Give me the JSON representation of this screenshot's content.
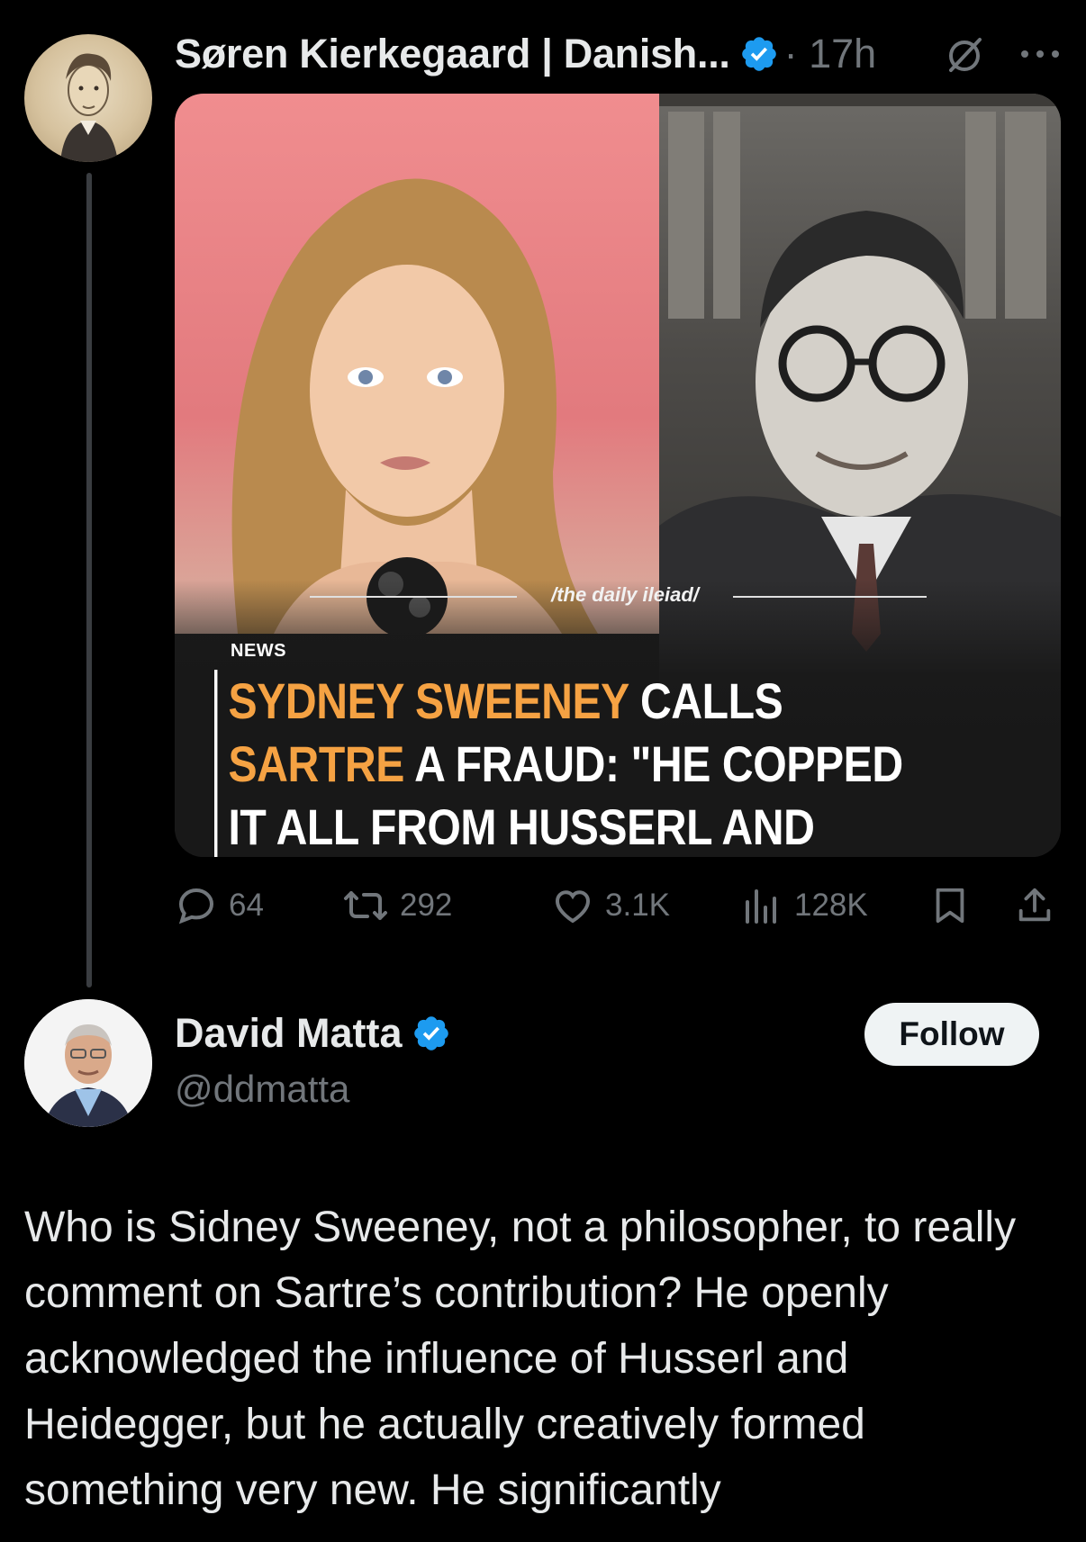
{
  "tweet1": {
    "author_name": "Søren Kierkegaard | Danish...",
    "time": "· 17h",
    "image": {
      "watermark": "/the daily ileiad/",
      "label": "NEWS",
      "headline_parts": [
        {
          "text": "SYDNEY SWEENEY",
          "highlight": true
        },
        {
          "text": " CALLS ",
          "highlight": false
        },
        {
          "text": "SARTRE",
          "highlight": true
        },
        {
          "text": " A FRAUD: \"HE COPPED IT ALL FROM HUSSERL AND HEIDEGGER.\"",
          "highlight": false
        }
      ],
      "highlight_color": "#f5a243"
    },
    "stats": {
      "replies": "64",
      "reposts": "292",
      "likes": "3.1K",
      "views": "128K"
    }
  },
  "tweet2": {
    "author_name": "David Matta",
    "handle": "@ddmatta",
    "follow_label": "Follow",
    "text": "Who is Sidney Sweeney, not a philosopher, to really comment on Sartre’s contribution? He openly acknowledged the influence of Husserl and Heidegger, but he actually creatively formed something very new. He significantly"
  },
  "colors": {
    "background": "#000000",
    "text_primary": "#e7e9ea",
    "text_secondary": "#71767b",
    "verified_blue": "#1d9bf0"
  }
}
